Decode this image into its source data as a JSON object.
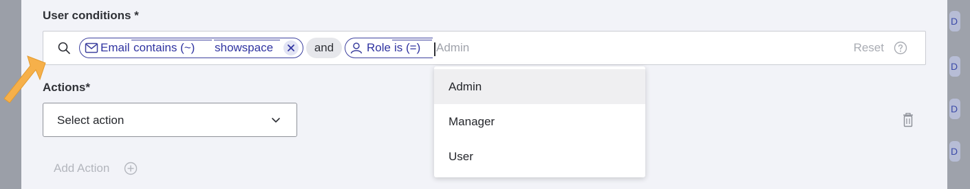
{
  "form": {
    "user_conditions_label": "User conditions *",
    "actions_label": "Actions*",
    "add_action_label": "Add Action"
  },
  "conditions": {
    "chips": [
      {
        "icon": "mail-icon",
        "field": "Email",
        "operator": "contains (~)",
        "value": "showspace",
        "removable": true
      },
      {
        "icon": "user-icon",
        "field": "Role",
        "operator": "is (=)",
        "value": ""
      }
    ],
    "joiner": "and",
    "input_value": "Admin",
    "reset_label": "Reset"
  },
  "action_select": {
    "value": "Select action"
  },
  "dropdown": {
    "options": [
      "Admin",
      "Manager",
      "User"
    ],
    "highlighted": "Admin"
  },
  "colors": {
    "chip_accent": "#3b3f9e",
    "arrow_annotation": "#f6b04a",
    "panel_bg": "#f2f3f8"
  },
  "icons": [
    "search-icon",
    "mail-icon",
    "close-icon",
    "user-icon",
    "help-icon",
    "chevron-down-icon",
    "trash-icon",
    "plus-circle-icon",
    "pointer-arrow-icon"
  ]
}
